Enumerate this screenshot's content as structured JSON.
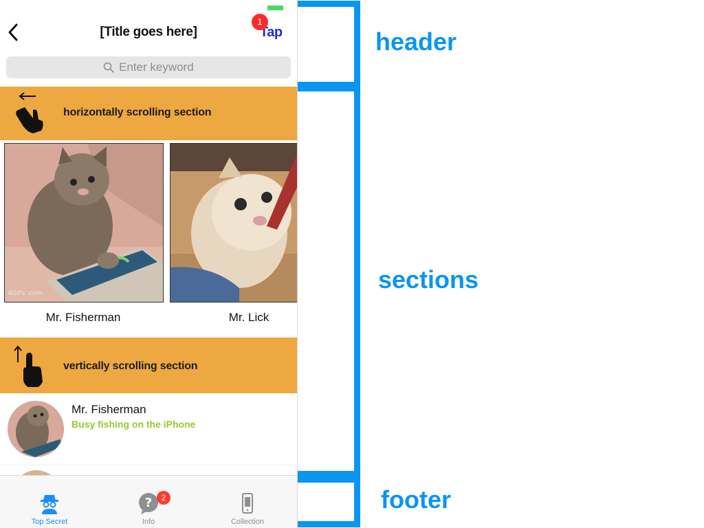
{
  "header": {
    "title": "[Title goes here]",
    "tap_label": "Tap",
    "tap_badge": "1",
    "search_placeholder": "Enter keyword"
  },
  "sections": {
    "horizontal": {
      "label": "horizontally scrolling section",
      "cards": [
        {
          "caption": "Mr. Fisherman",
          "watermark": "4GIFs .com"
        },
        {
          "caption": "Mr. Lick"
        }
      ]
    },
    "vertical": {
      "label": "vertically scrolling section",
      "items": [
        {
          "name": "Mr. Fisherman",
          "subtitle": "Busy fishing on the iPhone"
        }
      ]
    }
  },
  "tabbar": {
    "tabs": [
      {
        "label": "Top Secret",
        "icon": "spy-icon",
        "selected": true
      },
      {
        "label": "Info",
        "icon": "question-bubble-icon",
        "badge": "2"
      },
      {
        "label": "Collection",
        "icon": "phone-device-icon"
      }
    ]
  },
  "annotations": {
    "header": "header",
    "sections": "sections",
    "footer": "footer"
  },
  "colors": {
    "banner": "#eea841",
    "annotation": "#0a95f2",
    "subtitle": "#8fcc2e",
    "tab_active": "#1a8cff",
    "badge": "#ff3b30",
    "tap_text": "#1a2fd6"
  }
}
